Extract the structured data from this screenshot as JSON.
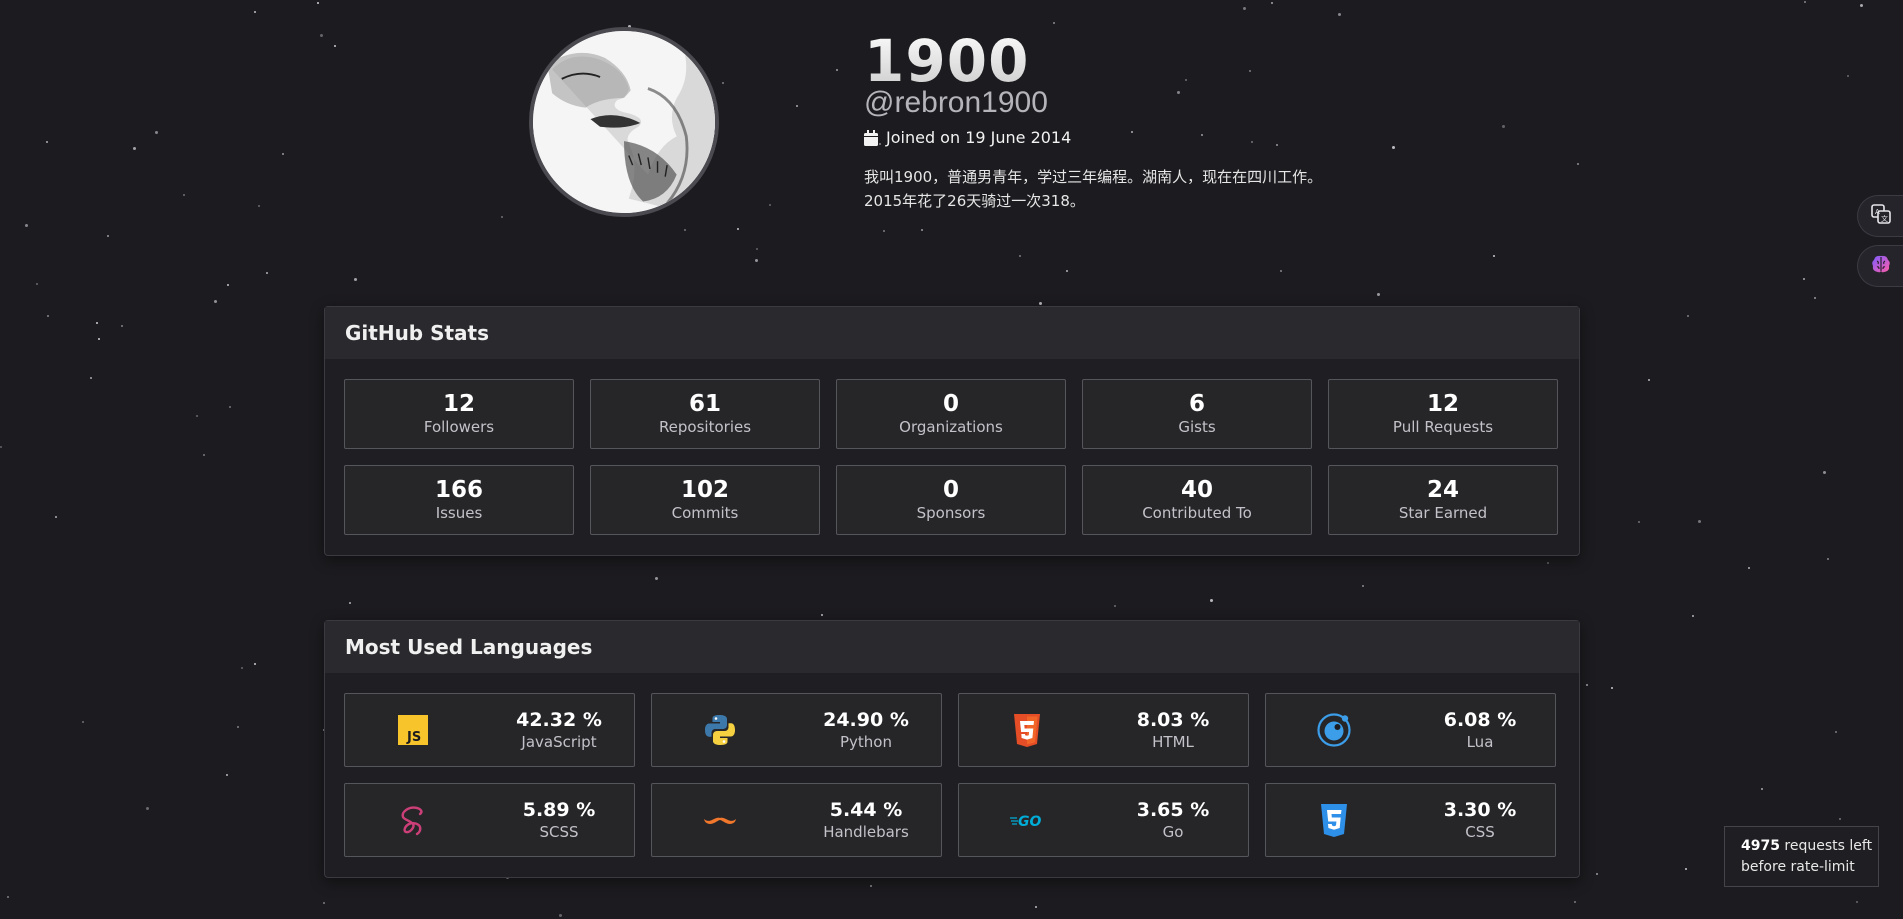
{
  "profile": {
    "display_name": "1900",
    "handle": "@rebron1900",
    "joined": "Joined on 19 June 2014",
    "bio_lines": [
      "我叫1900，普通男青年，学过三年编程。湖南人，现在在四川工作。",
      "2015年花了26天骑过一次318。"
    ]
  },
  "github_stats": {
    "title": "GitHub Stats",
    "items": [
      {
        "value": "12",
        "label": "Followers"
      },
      {
        "value": "61",
        "label": "Repositories"
      },
      {
        "value": "0",
        "label": "Organizations"
      },
      {
        "value": "6",
        "label": "Gists"
      },
      {
        "value": "12",
        "label": "Pull Requests"
      },
      {
        "value": "166",
        "label": "Issues"
      },
      {
        "value": "102",
        "label": "Commits"
      },
      {
        "value": "0",
        "label": "Sponsors"
      },
      {
        "value": "40",
        "label": "Contributed To"
      },
      {
        "value": "24",
        "label": "Star Earned"
      }
    ]
  },
  "languages": {
    "title": "Most Used Languages",
    "items": [
      {
        "percent": "42.32 %",
        "name": "JavaScript",
        "icon": "javascript-icon",
        "color": "#f7c52b"
      },
      {
        "percent": "24.90 %",
        "name": "Python",
        "icon": "python-icon",
        "color": "#3c78aa"
      },
      {
        "percent": "8.03 %",
        "name": "HTML",
        "icon": "html5-icon",
        "color": "#e44d26"
      },
      {
        "percent": "6.08 %",
        "name": "Lua",
        "icon": "lua-icon",
        "color": "#3c9de8"
      },
      {
        "percent": "5.89 %",
        "name": "SCSS",
        "icon": "sass-icon",
        "color": "#cd6799"
      },
      {
        "percent": "5.44 %",
        "name": "Handlebars",
        "icon": "handlebars-icon",
        "color": "#f0772b"
      },
      {
        "percent": "3.65 %",
        "name": "Go",
        "icon": "go-icon",
        "color": "#00add8"
      },
      {
        "percent": "3.30 %",
        "name": "CSS",
        "icon": "css3-icon",
        "color": "#1572b6"
      }
    ]
  },
  "rate_limit": {
    "count": "4975",
    "text_after_count": " requests left",
    "line2": "before rate-limit"
  },
  "side_buttons": [
    "translate-icon",
    "brain-icon"
  ]
}
